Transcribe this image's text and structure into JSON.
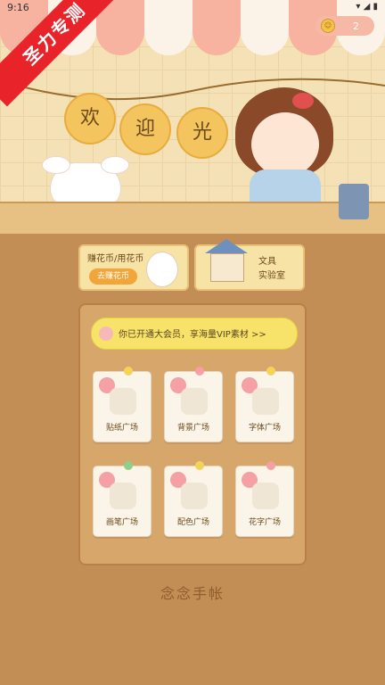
{
  "status_bar": {
    "time": "9:16",
    "icons": [
      "wifi-icon",
      "signal-icon",
      "battery-icon"
    ]
  },
  "badge": {
    "ribbon_text": "圣力专测"
  },
  "top": {
    "coin_count": "2",
    "welcome_chars": [
      "欢",
      "迎",
      "光"
    ]
  },
  "cards": {
    "earn": {
      "title": "赚花币/用花币",
      "button": "去赚花币"
    },
    "lab": {
      "line1": "文具",
      "line2": "实验室"
    }
  },
  "vip_banner": "你已开通大会员，享海量VIP素材 >>",
  "tiles": [
    {
      "label": "贴纸广场"
    },
    {
      "label": "背景广场"
    },
    {
      "label": "字体广场"
    },
    {
      "label": "画笔广场"
    },
    {
      "label": "配色广场"
    },
    {
      "label": "花字广场"
    }
  ],
  "footer": {
    "logo_text": "念念手帐"
  },
  "colors": {
    "page_bg": "#c38e55",
    "vip_bg": "#f8e36a",
    "ribbon": "#e8232a"
  }
}
